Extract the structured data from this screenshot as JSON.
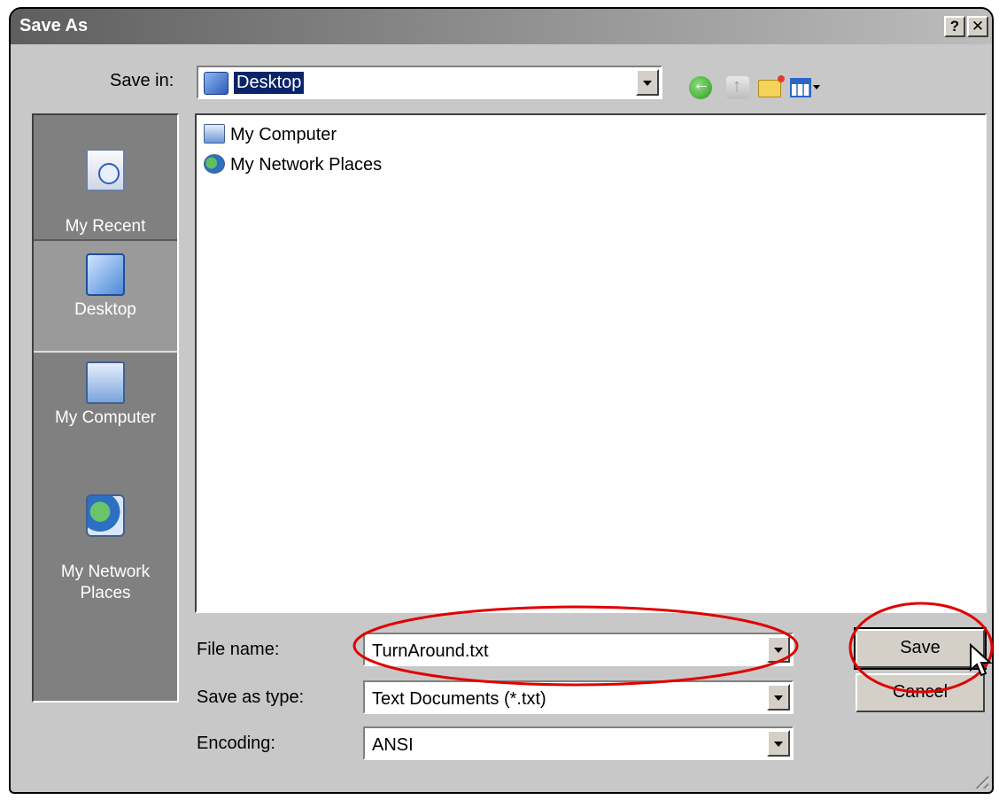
{
  "window": {
    "title": "Save As",
    "help_button": "?",
    "close_button": "✕"
  },
  "save_in": {
    "label": "Save in:",
    "value": "Desktop"
  },
  "toolbar": {
    "icons": [
      "back-icon",
      "up-folder-icon",
      "new-folder-icon",
      "views-menu-icon"
    ]
  },
  "places_bar": [
    {
      "label": "My Recent\nDocuments",
      "icon": "recent-documents-icon"
    },
    {
      "label": "Desktop",
      "icon": "desktop-icon",
      "selected": true
    },
    {
      "label": "My Computer",
      "icon": "my-computer-icon"
    },
    {
      "label": "My Network\nPlaces",
      "icon": "network-places-icon"
    }
  ],
  "file_list": [
    {
      "name": "My Computer",
      "icon": "my-computer-icon"
    },
    {
      "name": "My Network Places",
      "icon": "network-places-icon"
    }
  ],
  "fields": {
    "file_name": {
      "label": "File name:",
      "value": "TurnAround.txt"
    },
    "save_as_type": {
      "label": "Save as type:",
      "value": "Text Documents (*.txt)"
    },
    "encoding": {
      "label": "Encoding:",
      "value": "ANSI"
    }
  },
  "buttons": {
    "save": "Save",
    "cancel": "Cancel"
  },
  "colors": {
    "annotation": "#e00000",
    "selection": "#0a246a",
    "places_bg": "#808080",
    "dialog_bg": "#c8c8c8"
  }
}
